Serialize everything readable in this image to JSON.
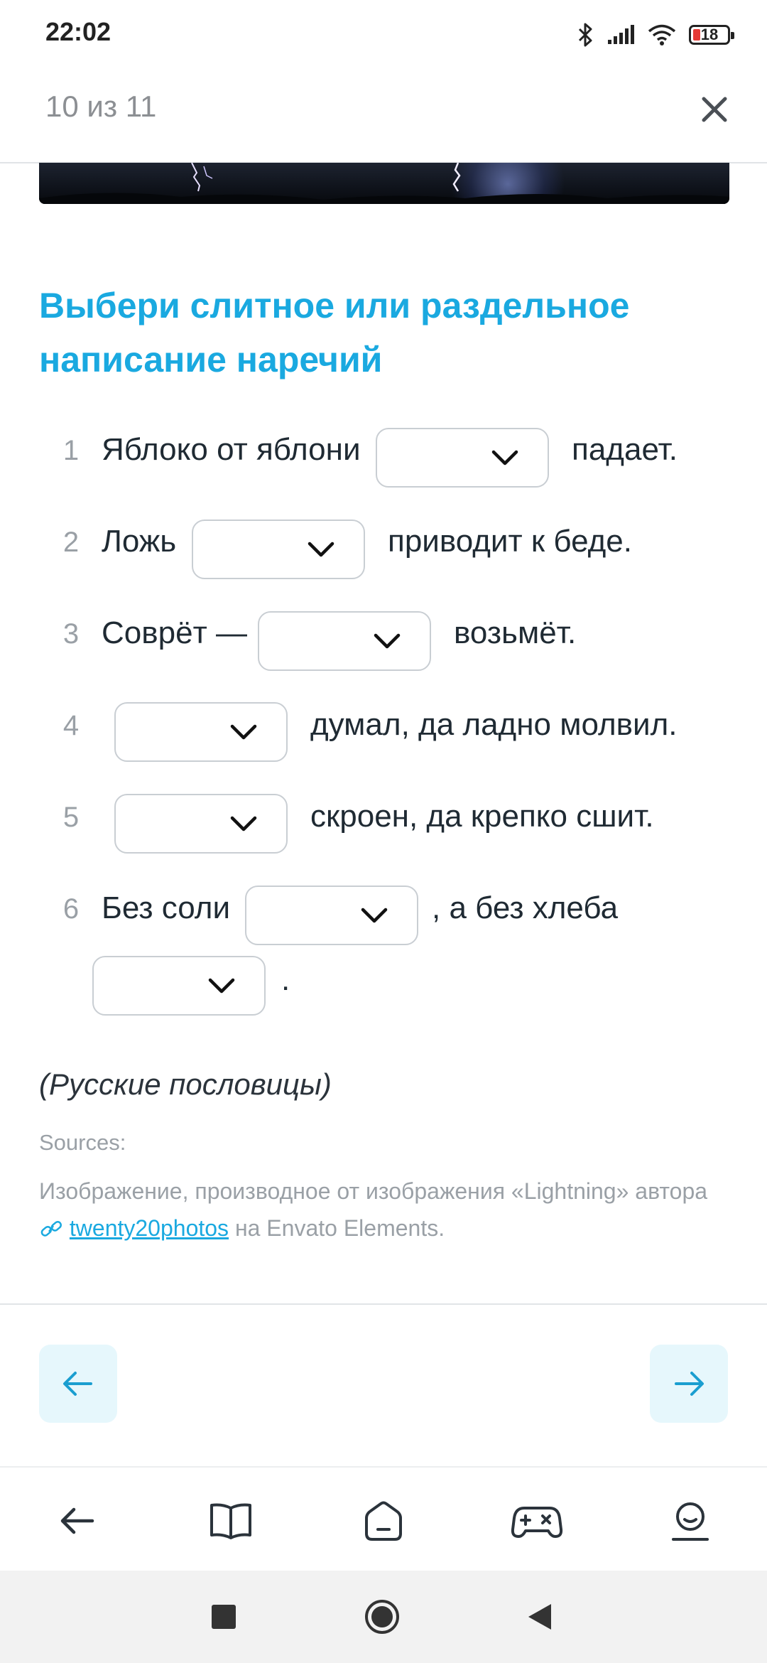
{
  "status_bar": {
    "time": "22:02",
    "battery": "18",
    "icons": [
      "bluetooth-icon",
      "signal-icon",
      "wifi-icon",
      "battery-icon"
    ]
  },
  "header": {
    "progress": "10 из 11"
  },
  "task": {
    "title": "Выбери слитное или раздельное написание наречий",
    "sentences": [
      {
        "number": "1",
        "before": "Яблоко от яблони",
        "after": "падает."
      },
      {
        "number": "2",
        "before": "Ложь",
        "after": "приводит к беде."
      },
      {
        "number": "3",
        "before": "Соврёт —",
        "after": "возьмёт."
      },
      {
        "number": "4",
        "before": "",
        "after": "думал, да ладно молвил."
      },
      {
        "number": "5",
        "before": "",
        "after": "скроен, да крепко сшит."
      },
      {
        "number": "6",
        "before": "Без соли",
        "after": ", а без хлеба",
        "end": "."
      }
    ],
    "source_note": "(Русские пословицы)",
    "sources_label": "Sources:",
    "credit_before": "Изображение, производное от изображения «Lightning» автора",
    "credit_link": "twenty20photos",
    "credit_after": "на Envato Elements."
  },
  "colors": {
    "accent": "#1aa9e0",
    "nav_button_bg": "#e6f7fc",
    "text": "#1f2a33",
    "muted": "#9aa0a6"
  }
}
